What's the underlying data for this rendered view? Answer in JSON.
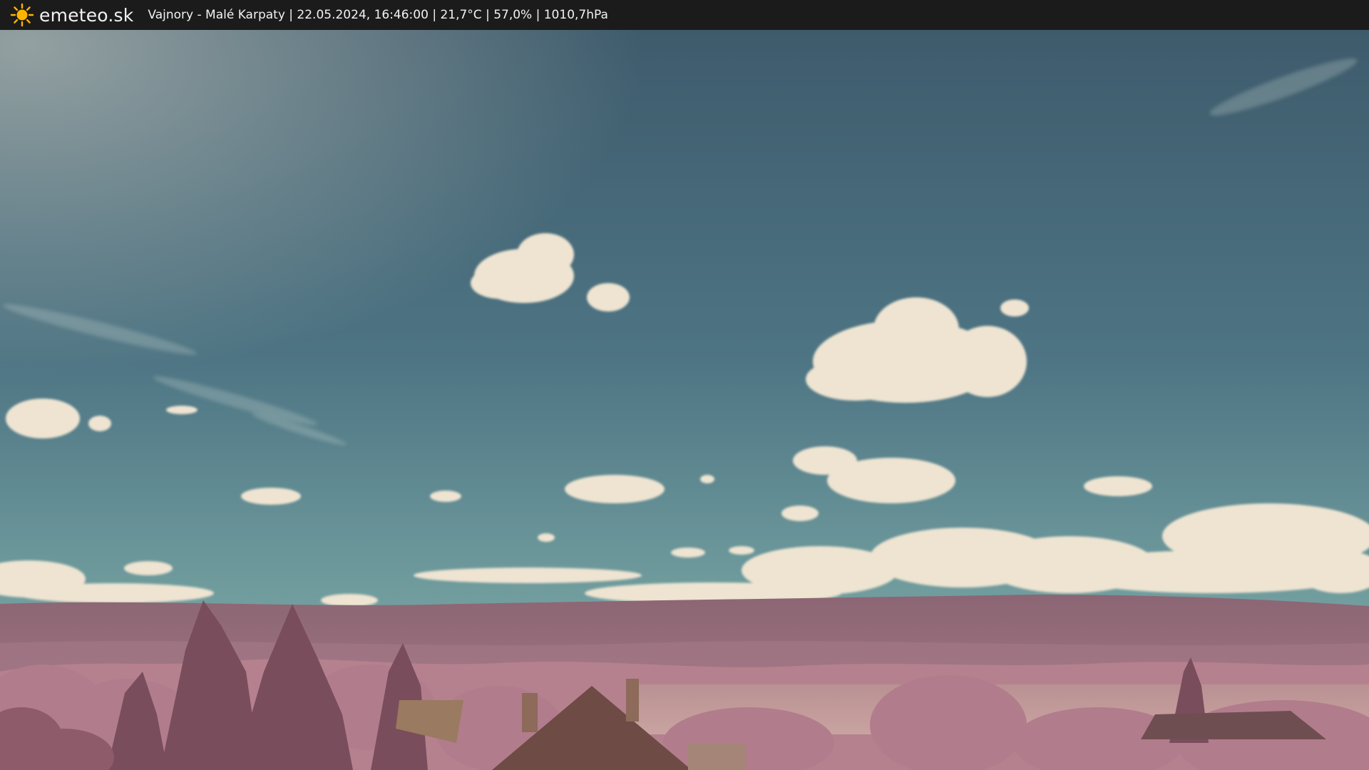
{
  "header": {
    "brand": "emeteo.sk",
    "logo_icon": "sun-icon",
    "info": "Vajnory - Malé Karpaty | 22.05.2024, 16:46:00 | 21,7°C | 57,0% | 1010,7hPa"
  },
  "colors": {
    "bar": "#1b1b1b",
    "sky_top": "#3f5d6e",
    "sky_bottom": "#7da4a6",
    "cloud": "#efe5d3",
    "hills": "#9a6f7c",
    "foliage": "#b07a8c",
    "sun_logo": "#ffb400"
  }
}
